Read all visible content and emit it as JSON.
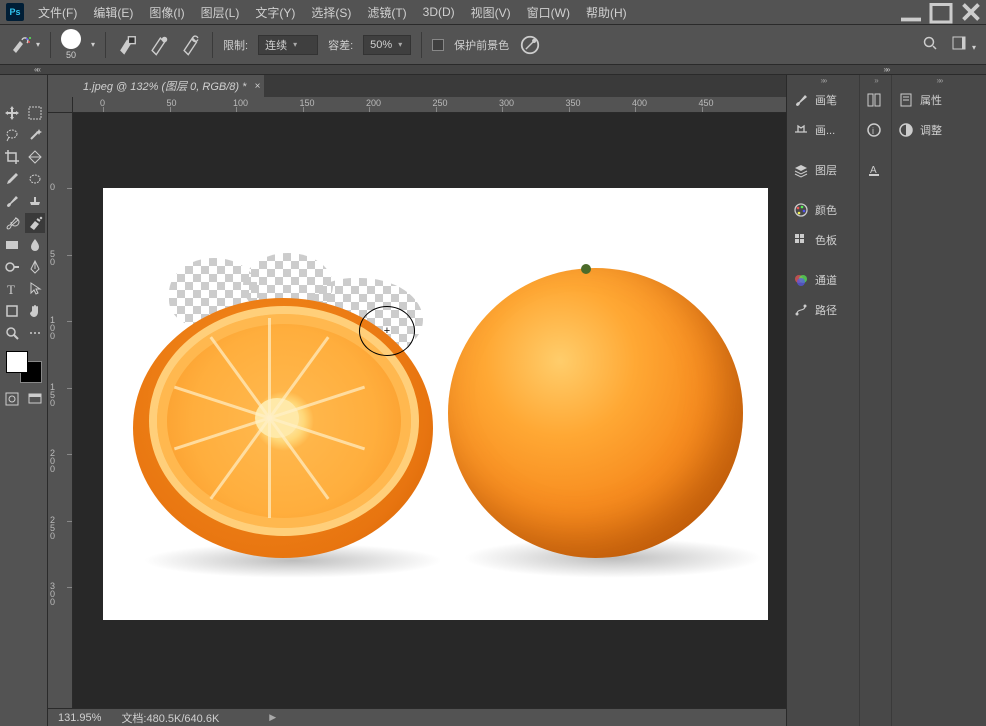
{
  "app": {
    "logo": "Ps"
  },
  "menu": [
    "文件(F)",
    "编辑(E)",
    "图像(I)",
    "图层(L)",
    "文字(Y)",
    "选择(S)",
    "滤镜(T)",
    "3D(D)",
    "视图(V)",
    "窗口(W)",
    "帮助(H)"
  ],
  "options": {
    "brush_size": "50",
    "limit_label": "限制:",
    "limit_value": "连续",
    "tolerance_label": "容差:",
    "tolerance_value": "50%",
    "protect_fg_label": "保护前景色"
  },
  "document": {
    "tab_title": "1.jpeg @ 132% (图层 0, RGB/8) *"
  },
  "ruler": {
    "h_ticks": [
      0,
      50,
      100,
      150,
      200,
      250,
      300,
      350,
      400,
      450
    ],
    "v_ticks": [
      0,
      50,
      100,
      150,
      200,
      250,
      300
    ]
  },
  "panels": {
    "col_a": [
      {
        "k": "brush",
        "label": "画笔"
      },
      {
        "k": "brush-presets",
        "label": "画..."
      },
      {
        "sep": true
      },
      {
        "k": "layers",
        "label": "图层"
      },
      {
        "sep": true
      },
      {
        "k": "color",
        "label": "颜色"
      },
      {
        "k": "swatches",
        "label": "色板"
      },
      {
        "sep": true
      },
      {
        "k": "channels",
        "label": "通道"
      },
      {
        "k": "paths",
        "label": "路径"
      }
    ],
    "col_b": [
      {
        "k": "history"
      },
      {
        "k": "info"
      },
      {
        "sep": true
      },
      {
        "k": "character"
      }
    ],
    "col_c": [
      {
        "k": "properties",
        "label": "属性"
      },
      {
        "k": "adjustments",
        "label": "调整"
      }
    ]
  },
  "status": {
    "zoom": "131.95%",
    "doc_label": "文档:",
    "doc_size": "480.5K/640.6K"
  }
}
